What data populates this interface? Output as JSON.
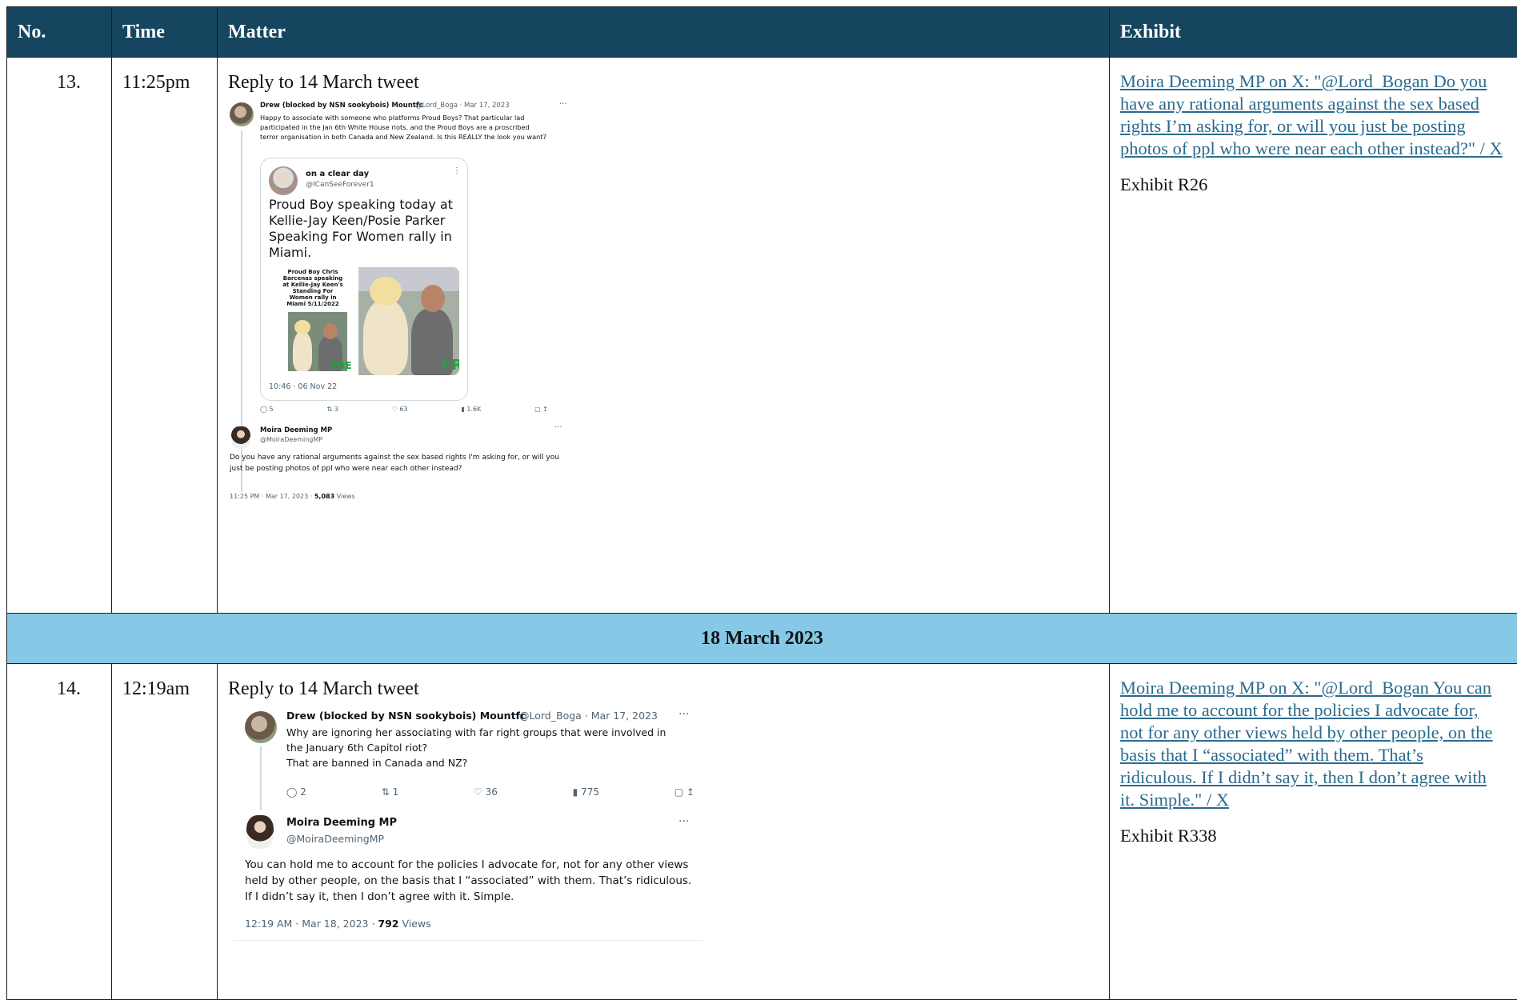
{
  "headers": {
    "no": "No.",
    "time": "Time",
    "matter": "Matter",
    "exhibit": "Exhibit"
  },
  "rows": [
    {
      "no": "13.",
      "time": "11:25pm",
      "matter": "Reply to 14 March tweet",
      "exhibit_link": "Moira Deeming MP on X: \"@Lord_Bogan Do you have any rational arguments against the sex based rights I’m asking for, or will you just be posting photos of ppl who were near each other instead?\" / X",
      "exhibit_num": "Exhibit R26",
      "tweet": {
        "parent_name": "Drew (blocked by NSN sookybois) Mountfc",
        "parent_handle": "@Lord_Boga · Mar 17, 2023",
        "parent_text": "Happy to associate with someone who platforms Proud Boys? That particular lad participated in the Jan 6th White House riots, and the Proud Boys are a proscribed terror organisation in both Canada and New Zealand. Is this REALLY the look you want?",
        "quote_name": "on a clear day",
        "quote_handle": "@ICanSeeForever1",
        "quote_text": "Proud Boy speaking today at Kellie-Jay Keen/Posie Parker Speaking For Women rally in Miami.",
        "photo_caption": "Proud Boy Chris Barcenas speaking at Kellie-Jay Keen's Standing For Women rally in Miami 5/11/2022",
        "quote_time": "10:46 · 06 Nov 22",
        "counts": [
          "5",
          "3",
          "63",
          "1.6K"
        ],
        "reply_name": "Moira Deeming MP",
        "reply_handle": "@MoiraDeemingMP",
        "reply_text": "Do you have any rational arguments against the sex based rights I'm asking for, or will you just be posting photos of ppl who were near each other instead?",
        "reply_meta_prefix": "11:25 PM · Mar 17, 2023 · ",
        "reply_views": "5,083",
        "reply_views_label": " Views"
      }
    },
    {
      "no": "14.",
      "time": "12:19am",
      "matter": "Reply to 14 March tweet",
      "exhibit_link": "Moira Deeming MP on X: \"@Lord_Bogan You can hold me to account for the policies I advocate for, not for any other views held by other people, on the basis that I “associated” with them. That’s ridiculous. If I didn’t say it, then I don’t agree with it. Simple.\" / X",
      "exhibit_num": "Exhibit R338",
      "tweet": {
        "parent_name": "Drew (blocked by NSN sookybois) Mountfc",
        "parent_handle": "@Lord_Boga · Mar 17, 2023",
        "parent_text_lines": [
          "Why are ignoring her associating with far right groups that were involved in",
          "the January 6th Capitol riot?",
          "That are banned in Canada and NZ?"
        ],
        "counts": [
          "2",
          "1",
          "36",
          "775"
        ],
        "reply_name": "Moira Deeming MP",
        "reply_handle": "@MoiraDeemingMP",
        "reply_text": "You can hold me to account for the policies I advocate for, not for any other views held by other people, on the basis that I “associated” with them. That’s ridiculous. If I didn’t say it, then I don’t agree with it. Simple.",
        "reply_meta_prefix": "12:19 AM · Mar 18, 2023 · ",
        "reply_views": "792",
        "reply_views_label": " Views"
      }
    }
  ],
  "date_divider": "18 March 2023",
  "colors": {
    "header_bg": "#16465f",
    "divider_bg": "#86c8e6",
    "link": "#2a6b8e"
  }
}
